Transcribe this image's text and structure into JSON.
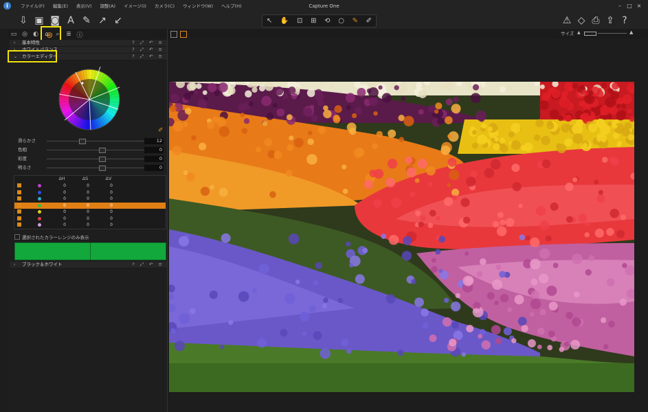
{
  "app": {
    "title": "Capture One",
    "icon": "i"
  },
  "menu": [
    "ファイル(F)",
    "編集(E)",
    "表示(V)",
    "調整(A)",
    "イメージ(I)",
    "カメラ(C)",
    "ウィンドウ(W)",
    "ヘルプ(H)"
  ],
  "window_controls": [
    "–",
    "□",
    "×"
  ],
  "toolbar_left_icons": [
    "import-icon",
    "capture-icon",
    "camera-icon",
    "text-icon",
    "brush-icon",
    "arrow-up-right-icon",
    "arrow-down-left-icon"
  ],
  "toolbar_right_icons": [
    "warning-icon",
    "eye-icon",
    "print-icon",
    "export-icon",
    "help-icon"
  ],
  "cursor_tools": [
    "↖",
    "✋",
    "⊡",
    "⊞",
    "⟲",
    "○",
    "✎",
    "✐"
  ],
  "tool_tabs": [
    "folder-icon",
    "lens-icon",
    "color-icon",
    "tag-icon",
    "search-icon",
    "list-icon",
    "info-icon"
  ],
  "sections": {
    "basic": "基本特性",
    "white_balance": "ホワイトバランス",
    "color_editor": "カラーエディター",
    "bw": "ブラック＆ホワイト"
  },
  "section_controls": "? ⤢ ↶ ≡",
  "sliders": [
    {
      "label": "滑らかさ",
      "value": "12",
      "pos": 0.32
    },
    {
      "label": "色相",
      "value": "0",
      "pos": 0.5
    },
    {
      "label": "彩度",
      "value": "0",
      "pos": 0.5
    },
    {
      "label": "明るさ",
      "value": "0",
      "pos": 0.5
    }
  ],
  "table": {
    "headers": [
      "ΔH",
      "ΔS",
      "ΔV"
    ],
    "rows": [
      {
        "color": "#c040d0",
        "dh": "0",
        "ds": "0",
        "dv": "0",
        "selected": false
      },
      {
        "color": "#3050e0",
        "dh": "0",
        "ds": "0",
        "dv": "0",
        "selected": false
      },
      {
        "color": "#30b0d0",
        "dh": "0",
        "ds": "0",
        "dv": "0",
        "selected": false
      },
      {
        "color": "#30c040",
        "dh": "0",
        "ds": "0",
        "dv": "0",
        "selected": true
      },
      {
        "color": "#e0d020",
        "dh": "0",
        "ds": "0",
        "dv": "0",
        "selected": false
      },
      {
        "color": "#e04040",
        "dh": "0",
        "ds": "0",
        "dv": "0",
        "selected": false
      },
      {
        "color": "#d0a0e0",
        "dh": "0",
        "ds": "0",
        "dv": "0",
        "selected": false
      }
    ]
  },
  "selected_only_label": "選択されたカラーレンジのみ表示",
  "viewer": {
    "size_label": "サイズ"
  }
}
